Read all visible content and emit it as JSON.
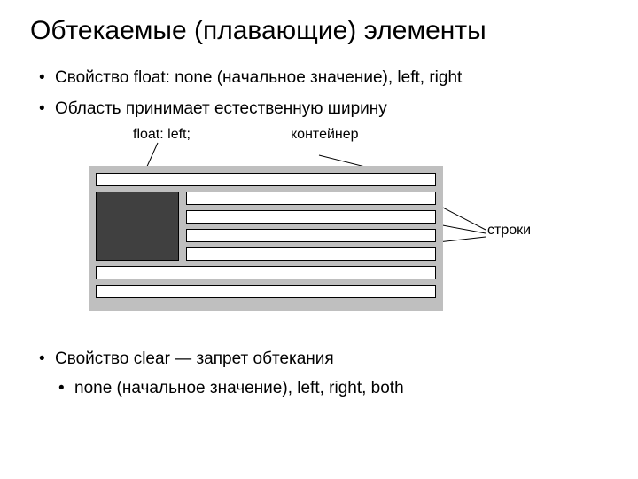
{
  "title": "Обтекаемые (плавающие) элементы",
  "bullets": {
    "b1": "Свойство float:  none (начальное значение), left, right",
    "b2": "Область принимает естественную ширину",
    "b3": "Свойство clear — запрет обтекания",
    "b3a": "none (начальное значение), left, right, both"
  },
  "diagram": {
    "label_float": "float: left;",
    "label_container": "контейнер",
    "label_lines": "строки"
  }
}
